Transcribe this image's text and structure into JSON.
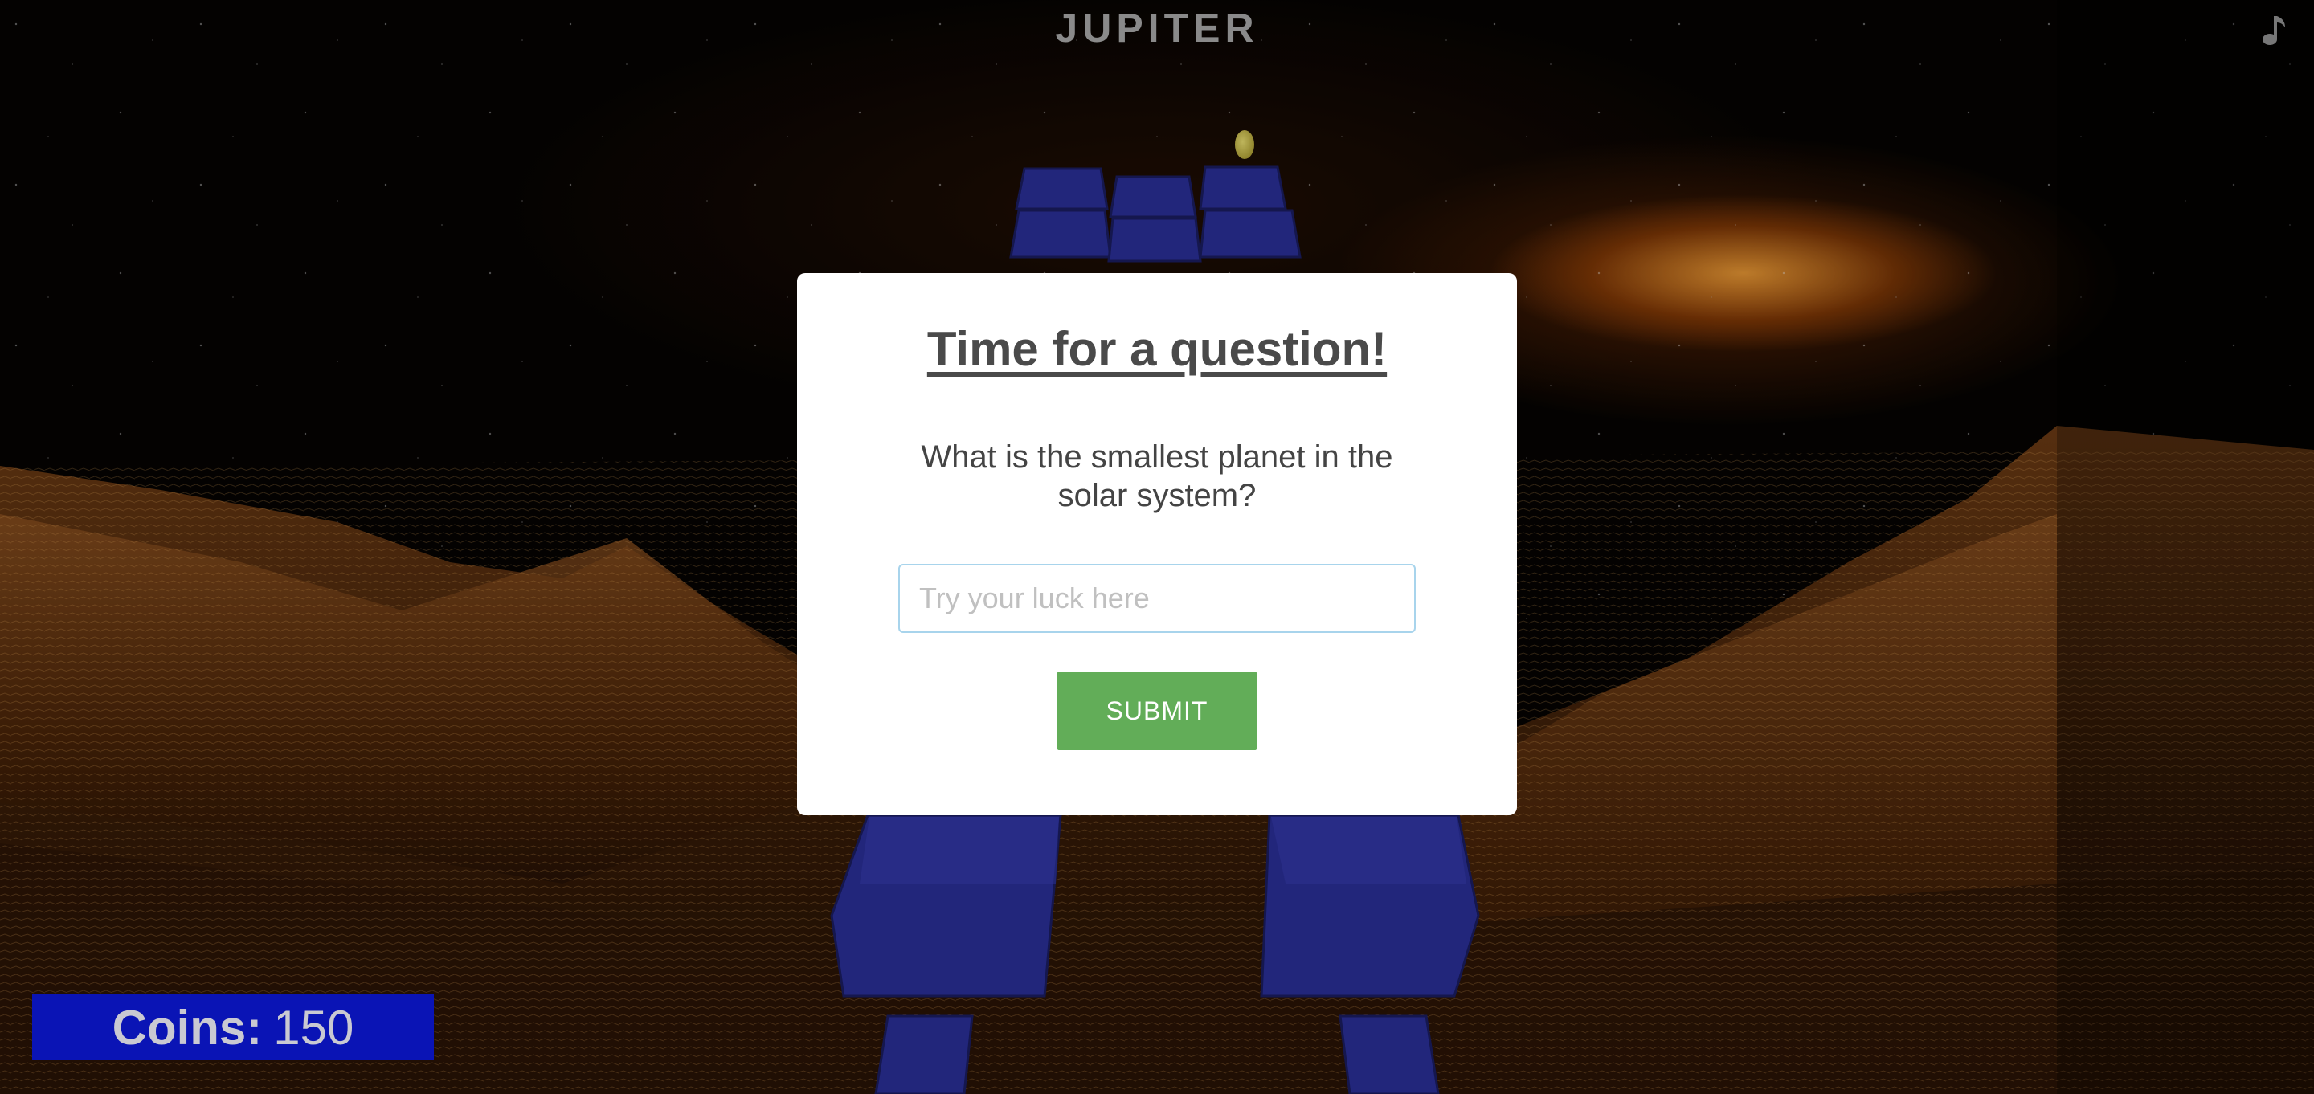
{
  "game": {
    "title": "JUPITER",
    "music_icon": "music-note-icon"
  },
  "question_modal": {
    "heading": "Time for a question!",
    "question": "What is the smallest planet in the solar system?",
    "answer_placeholder": "Try your luck here",
    "answer_value": "",
    "submit_label": "SUBMIT"
  },
  "hud": {
    "coins_label": "Coins:",
    "coins_value": "150"
  },
  "colors": {
    "blocks": "#2a2f96",
    "hud_background": "#0a14b5",
    "submit_button": "#62ad58"
  }
}
